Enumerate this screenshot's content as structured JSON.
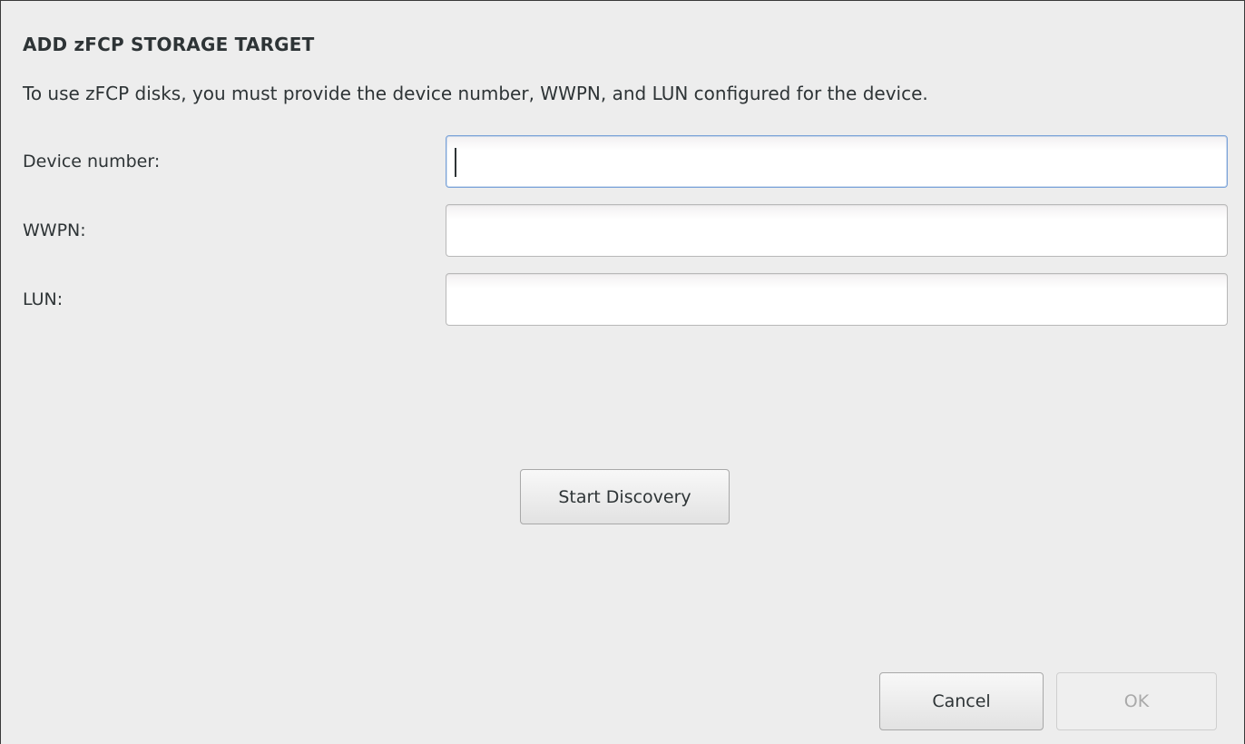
{
  "dialog": {
    "title": "ADD zFCP STORAGE TARGET",
    "description": "To use zFCP disks, you must provide the device number, WWPN, and LUN configured for the device."
  },
  "fields": {
    "device_number": {
      "label": "Device number:",
      "value": "",
      "focused": true
    },
    "wwpn": {
      "label": "WWPN:",
      "value": ""
    },
    "lun": {
      "label": "LUN:",
      "value": ""
    }
  },
  "buttons": {
    "start_discovery": "Start Discovery",
    "cancel": "Cancel",
    "ok": "OK",
    "ok_enabled": false
  },
  "colors": {
    "background": "#ededed",
    "text": "#2e3436",
    "focus_border": "#7aa2d8",
    "disabled_text": "#a9a9a9"
  }
}
